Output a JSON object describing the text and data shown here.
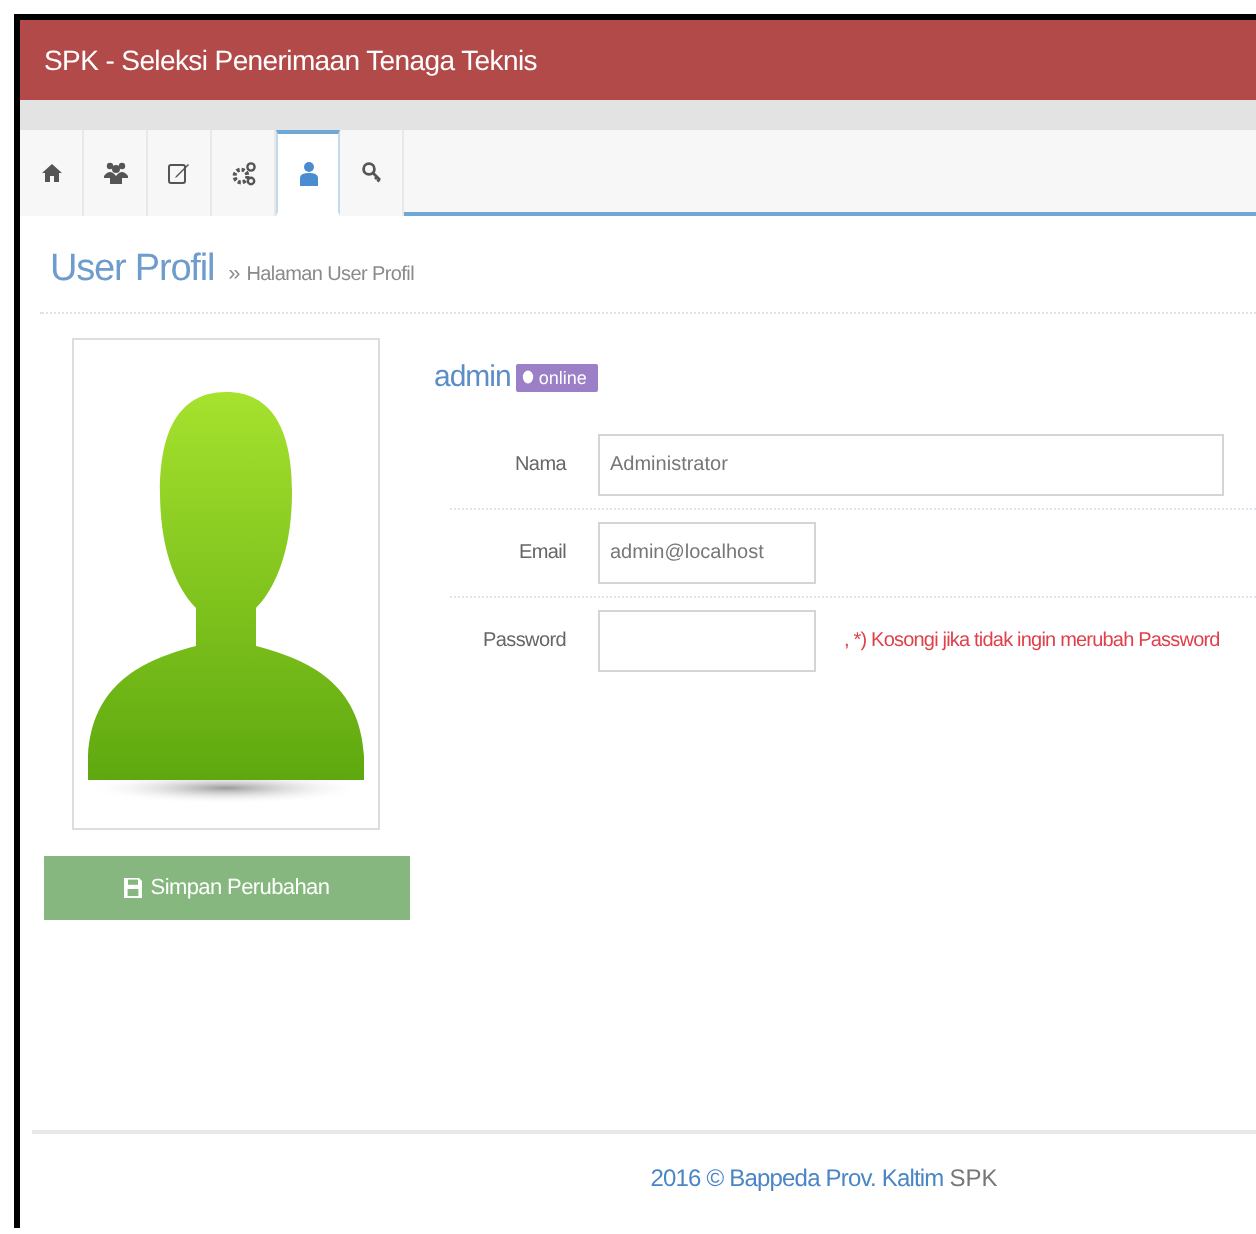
{
  "header": {
    "title": "SPK - Seleksi Penerimaan Tenaga Teknis"
  },
  "tabs": [
    {
      "selected": false
    },
    {
      "selected": false
    },
    {
      "selected": false
    },
    {
      "selected": false
    },
    {
      "selected": true
    },
    {
      "selected": false
    }
  ],
  "page": {
    "title": "User Profil",
    "breadcrumb_mark": "»",
    "breadcrumb": "Halaman User Profil"
  },
  "profile": {
    "username": "admin",
    "status": "online",
    "online": true,
    "save_button": "Simpan Perubahan"
  },
  "form": [
    {
      "label": "Nama",
      "value": "Administrator",
      "wide": true
    },
    {
      "label": "Email",
      "value": "admin@localhost",
      "wide": false
    },
    {
      "label": "Password",
      "wide": false,
      "note": ", *) Kosongi jika tidak ingin merubah Password"
    }
  ],
  "footer": {
    "credit": "2016 © Bappeda Prov. Kaltim",
    "app": "SPK"
  }
}
